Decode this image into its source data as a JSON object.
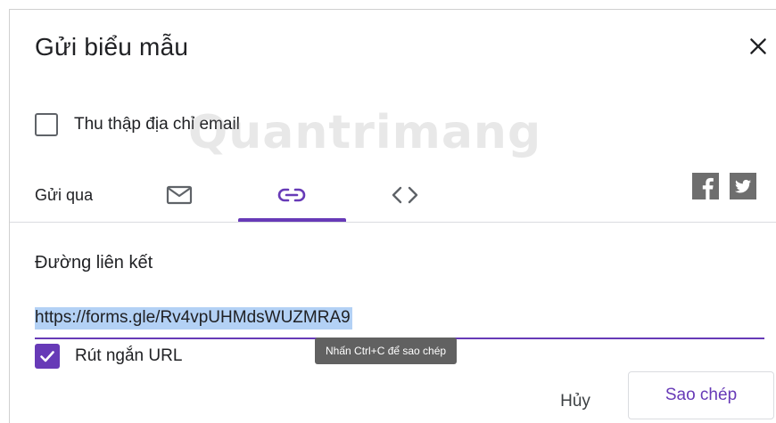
{
  "dialog": {
    "title": "Gửi biểu mẫu",
    "close_icon": "close-icon",
    "collect_email_label": "Thu thập địa chỉ email",
    "collect_email_checked": false,
    "send_via_label": "Gửi qua",
    "tabs": [
      {
        "icon": "mail-icon",
        "active": false
      },
      {
        "icon": "link-icon",
        "active": true
      },
      {
        "icon": "embed-code-icon",
        "active": false
      }
    ],
    "social": [
      {
        "icon": "facebook-icon"
      },
      {
        "icon": "twitter-icon"
      }
    ],
    "link_section_title": "Đường liên kết",
    "url_value": "https://forms.gle/Rv4vpUHMdsWUZMRA9",
    "tooltip": "Nhấn Ctrl+C để sao chép",
    "shorten_url_label": "Rút ngắn URL",
    "shorten_url_checked": true,
    "cancel_label": "Hủy",
    "copy_label": "Sao chép"
  },
  "watermark": "Quantrimang",
  "colors": {
    "accent": "#673ab7",
    "selection": "#b3d1f5",
    "tooltip_bg": "#616161"
  }
}
